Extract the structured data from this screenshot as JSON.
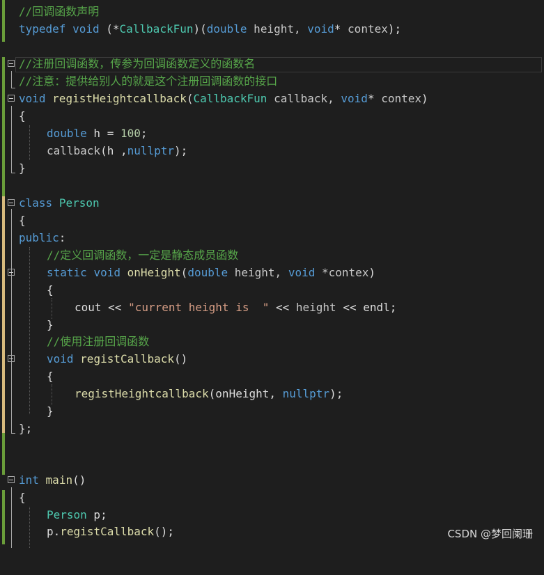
{
  "code": {
    "l1": {
      "comment": "//回调函数声明"
    },
    "l2": {
      "kw_typedef": "typedef",
      "kw_void": "void",
      "p1": " (*",
      "fn": "CallbackFun",
      "p2": ")(",
      "kw_double": "double",
      "param": " height, ",
      "kw_void2": "void",
      "star": "* ",
      "param2": "contex",
      "end": ");"
    },
    "l4": {
      "comment": "//注册回调函数，传参为回调函数定义的函数名"
    },
    "l5": {
      "comment": "//注意：提供给别人的就是这个注册回调函数的接口"
    },
    "l6": {
      "kw_void": "void",
      "sp": " ",
      "fn": "registHeightcallback",
      "p1": "(",
      "type": "CallbackFun",
      "param": " callback, ",
      "kw_void2": "void",
      "star": "* ",
      "param2": "contex",
      "end": ")"
    },
    "l7": {
      "brace": "{"
    },
    "l8": {
      "kw_double": "double",
      "var": " h = ",
      "num": "100",
      "end": ";"
    },
    "l9": {
      "fn": "callback",
      "p1": "(",
      "var": "h",
      "p2": " ,",
      "kw": "nullptr",
      "end": ");"
    },
    "l10": {
      "brace": "}"
    },
    "l12": {
      "kw_class": "class",
      "sp": " ",
      "type": "Person"
    },
    "l13": {
      "brace": "{"
    },
    "l14": {
      "kw_public": "public",
      "colon": ":"
    },
    "l15": {
      "comment": "//定义回调函数，一定是静态成员函数"
    },
    "l16": {
      "kw_static": "static",
      "sp": " ",
      "kw_void": "void",
      "sp2": " ",
      "fn": "onHeight",
      "p1": "(",
      "kw_double": "double",
      "param": " height, ",
      "kw_void2": "void",
      "param2": " *contex",
      "end": ")"
    },
    "l17": {
      "brace": "{"
    },
    "l18": {
      "var": "cout",
      "op": " << ",
      "str": "\"current height is  \"",
      "op2": " << ",
      "var2": "height",
      "op3": " << ",
      "fn": "endl",
      "end": ";"
    },
    "l19": {
      "brace": "}"
    },
    "l20": {
      "comment": "//使用注册回调函数"
    },
    "l21": {
      "kw_void": "void",
      "sp": " ",
      "fn": "registCallback",
      "end": "()"
    },
    "l22": {
      "brace": "{"
    },
    "l23": {
      "fn": "registHeightcallback",
      "p1": "(",
      "arg": "onHeight",
      "p2": ", ",
      "kw": "nullptr",
      "end": ");"
    },
    "l24": {
      "brace": "}"
    },
    "l25": {
      "brace": "};"
    },
    "l28": {
      "kw_int": "int",
      "sp": " ",
      "fn": "main",
      "end": "()"
    },
    "l29": {
      "brace": "{"
    },
    "l30": {
      "type": "Person",
      "var": " p",
      "end": ";"
    },
    "l31": {
      "var": "p",
      "dot": ".",
      "fn": "registCallback",
      "end": "();"
    }
  },
  "watermark": "CSDN @梦回阑珊"
}
